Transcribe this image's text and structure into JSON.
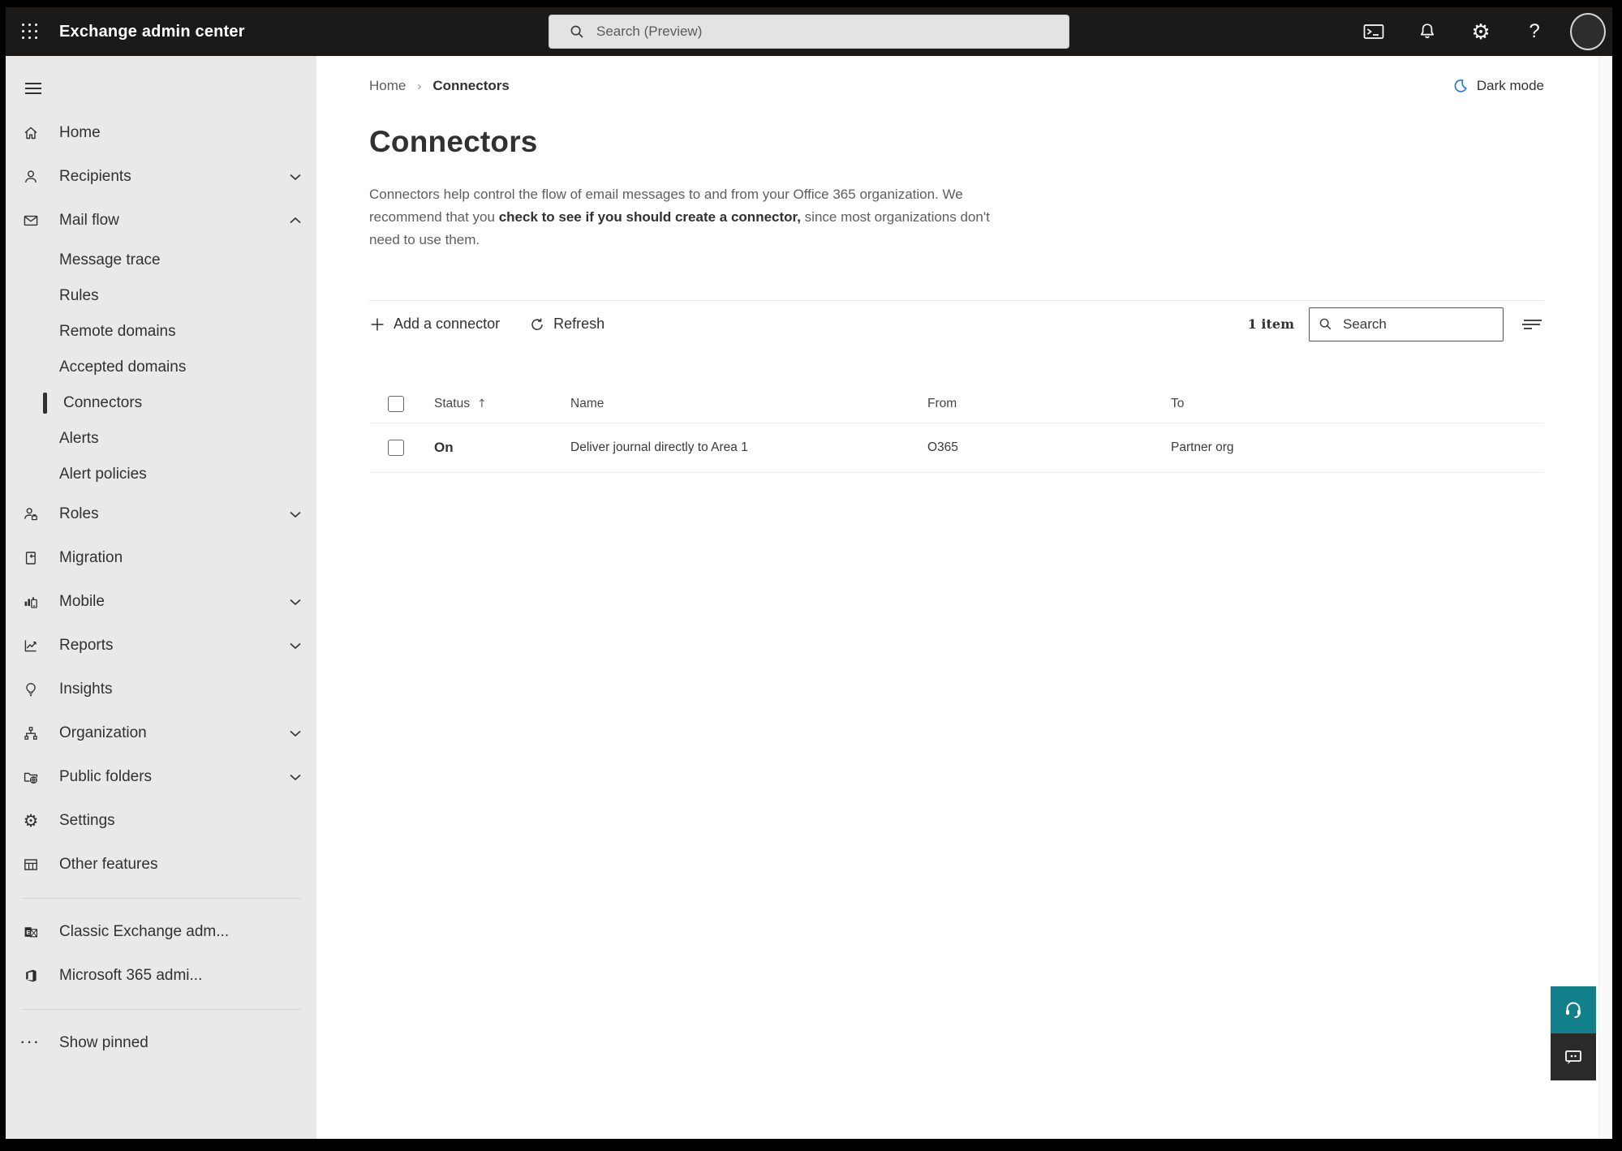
{
  "colors": {
    "topbar": "#1b1a19",
    "sidebar_bg": "#e9e9e9",
    "accent_teal": "#12808a",
    "moon_blue": "#2b7bd6",
    "text_primary": "#323130",
    "text_secondary": "#605e5c",
    "selection_indicator": "#31302f"
  },
  "topbar": {
    "app_title": "Exchange admin center",
    "search_placeholder": "Search (Preview)",
    "icons": [
      "app-launcher-icon",
      "terminal-icon",
      "bell-icon",
      "gear-icon",
      "help-icon",
      "avatar"
    ]
  },
  "sidebar": {
    "items": [
      {
        "label": "Home"
      },
      {
        "label": "Recipients",
        "expandable": true
      },
      {
        "label": "Mail flow",
        "expandable": true,
        "expanded": true
      },
      {
        "label": "Message trace",
        "sub": true
      },
      {
        "label": "Rules",
        "sub": true
      },
      {
        "label": "Remote domains",
        "sub": true
      },
      {
        "label": "Accepted domains",
        "sub": true
      },
      {
        "label": "Connectors",
        "sub": true,
        "selected": true
      },
      {
        "label": "Alerts",
        "sub": true
      },
      {
        "label": "Alert policies",
        "sub": true
      },
      {
        "label": "Roles",
        "expandable": true
      },
      {
        "label": "Migration"
      },
      {
        "label": "Mobile",
        "expandable": true
      },
      {
        "label": "Reports",
        "expandable": true
      },
      {
        "label": "Insights"
      },
      {
        "label": "Organization",
        "expandable": true
      },
      {
        "label": "Public folders",
        "expandable": true
      },
      {
        "label": "Settings"
      },
      {
        "label": "Other features"
      }
    ],
    "footer_items": [
      {
        "label": "Classic Exchange adm..."
      },
      {
        "label": "Microsoft 365 admi..."
      }
    ],
    "show_pinned": "Show pinned"
  },
  "breadcrumb": {
    "home": "Home",
    "current": "Connectors"
  },
  "dark_mode_label": "Dark mode",
  "page": {
    "title": "Connectors",
    "description": {
      "line1": "Connectors help control the flow of email messages to and from your Office 365 organization. We",
      "line2_pre": "recommend that you ",
      "line2_em": "check to see if you should create a connector,",
      "line2_post": " since most organizations don't",
      "line3": "need to use them."
    }
  },
  "toolbar": {
    "add_label": "Add a connector",
    "refresh_label": "Refresh",
    "item_count": "1 item",
    "search_placeholder": "Search"
  },
  "table": {
    "columns": {
      "status": "Status",
      "name": "Name",
      "from": "From",
      "to": "To"
    },
    "sort_arrow": "↑",
    "rows": [
      {
        "status": "On",
        "name": "Deliver journal directly to Area 1",
        "from": "O365",
        "to": "Partner org"
      }
    ]
  }
}
